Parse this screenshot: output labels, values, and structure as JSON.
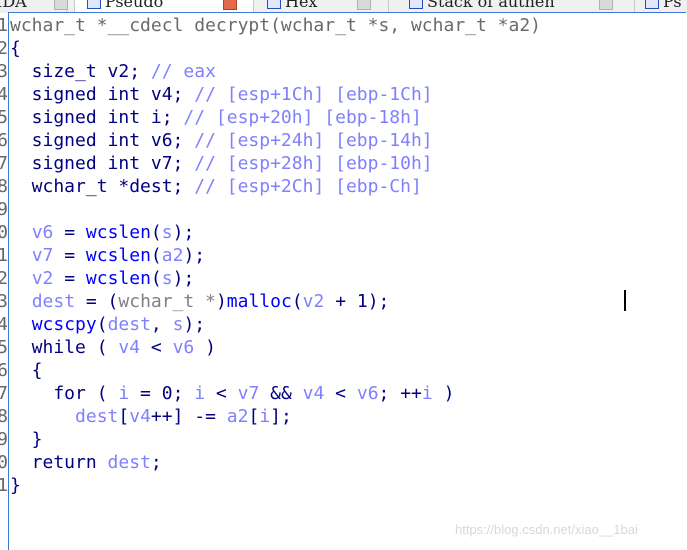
{
  "tabs": [
    {
      "label": "IDA",
      "active": false
    },
    {
      "label": "Pseudo",
      "active": true
    },
    {
      "label": "Hex",
      "active": false
    },
    {
      "label": "Stack of authen",
      "active": false
    },
    {
      "label": "Ps",
      "active": false
    }
  ],
  "code": {
    "lines": [
      [
        [
          "wchar_t *__cdecl decrypt(wchar_t *s, wchar_t *a2)",
          "h"
        ]
      ],
      [
        [
          "{",
          "p"
        ]
      ],
      [
        [
          "  size_t v2; ",
          "k"
        ],
        [
          "// eax",
          "c"
        ]
      ],
      [
        [
          "  signed int v4; ",
          "k"
        ],
        [
          "// [esp+1Ch] [ebp-1Ch]",
          "c"
        ]
      ],
      [
        [
          "  signed int i; ",
          "k"
        ],
        [
          "// [esp+20h] [ebp-18h]",
          "c"
        ]
      ],
      [
        [
          "  signed int v6; ",
          "k"
        ],
        [
          "// [esp+24h] [ebp-14h]",
          "c"
        ]
      ],
      [
        [
          "  signed int v7; ",
          "k"
        ],
        [
          "// [esp+28h] [ebp-10h]",
          "c"
        ]
      ],
      [
        [
          "  wchar_t *dest; ",
          "k"
        ],
        [
          "// [esp+2Ch] [ebp-Ch]",
          "c"
        ]
      ],
      [
        [
          "",
          "p"
        ]
      ],
      [
        [
          "  ",
          "p"
        ],
        [
          "v6",
          "v"
        ],
        [
          " = ",
          "p"
        ],
        [
          "wcslen",
          "f"
        ],
        [
          "(",
          "p"
        ],
        [
          "s",
          "v"
        ],
        [
          ");",
          "p"
        ]
      ],
      [
        [
          "  ",
          "p"
        ],
        [
          "v7",
          "v"
        ],
        [
          " = ",
          "p"
        ],
        [
          "wcslen",
          "f"
        ],
        [
          "(",
          "p"
        ],
        [
          "a2",
          "v"
        ],
        [
          ");",
          "p"
        ]
      ],
      [
        [
          "  ",
          "p"
        ],
        [
          "v2",
          "v"
        ],
        [
          " = ",
          "p"
        ],
        [
          "wcslen",
          "f"
        ],
        [
          "(",
          "p"
        ],
        [
          "s",
          "v"
        ],
        [
          ");",
          "p"
        ]
      ],
      [
        [
          "  ",
          "p"
        ],
        [
          "dest",
          "v"
        ],
        [
          " = (",
          "p"
        ],
        [
          "wchar_t *",
          "g"
        ],
        [
          ")",
          "p"
        ],
        [
          "malloc",
          "f"
        ],
        [
          "(",
          "p"
        ],
        [
          "v2",
          "v"
        ],
        [
          " + 1);",
          "p"
        ]
      ],
      [
        [
          "  ",
          "p"
        ],
        [
          "wcscpy",
          "f"
        ],
        [
          "(",
          "p"
        ],
        [
          "dest",
          "v"
        ],
        [
          ", ",
          "p"
        ],
        [
          "s",
          "v"
        ],
        [
          ");",
          "p"
        ]
      ],
      [
        [
          "  while ( ",
          "k"
        ],
        [
          "v4",
          "v"
        ],
        [
          " < ",
          "p"
        ],
        [
          "v6",
          "v"
        ],
        [
          " )",
          "p"
        ]
      ],
      [
        [
          "  {",
          "p"
        ]
      ],
      [
        [
          "    for ( ",
          "k"
        ],
        [
          "i",
          "v"
        ],
        [
          " = 0; ",
          "p"
        ],
        [
          "i",
          "v"
        ],
        [
          " < ",
          "p"
        ],
        [
          "v7",
          "v"
        ],
        [
          " && ",
          "p"
        ],
        [
          "v4",
          "v"
        ],
        [
          " < ",
          "p"
        ],
        [
          "v6",
          "v"
        ],
        [
          "; ++",
          "p"
        ],
        [
          "i",
          "v"
        ],
        [
          " )",
          "p"
        ]
      ],
      [
        [
          "      ",
          "p"
        ],
        [
          "dest",
          "v"
        ],
        [
          "[",
          "p"
        ],
        [
          "v4",
          "v"
        ],
        [
          "++] -= ",
          "p"
        ],
        [
          "a2",
          "v"
        ],
        [
          "[",
          "p"
        ],
        [
          "i",
          "v"
        ],
        [
          "];",
          "p"
        ]
      ],
      [
        [
          "  }",
          "p"
        ]
      ],
      [
        [
          "  return ",
          "k"
        ],
        [
          "dest",
          "v"
        ],
        [
          ";",
          "p"
        ]
      ],
      [
        [
          "}",
          "p"
        ]
      ]
    ]
  },
  "watermark": "https://blog.csdn.net/xiao__1bai"
}
